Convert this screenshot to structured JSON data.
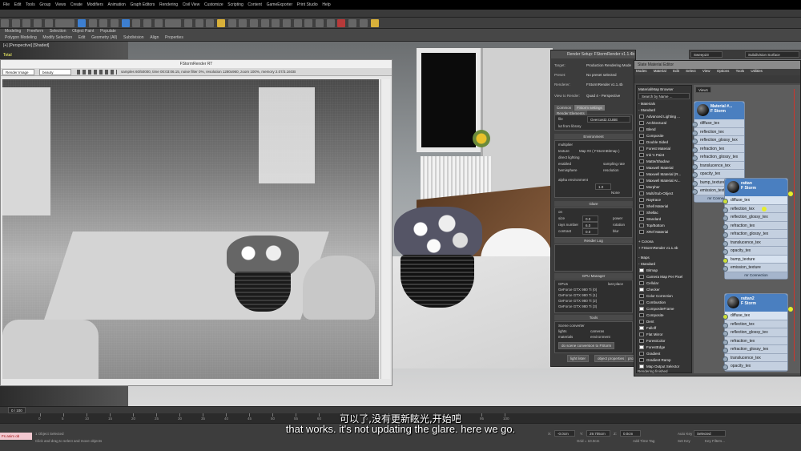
{
  "menubar": {
    "items": [
      "File",
      "Edit",
      "Tools",
      "Group",
      "Views",
      "Create",
      "Modifiers",
      "Animation",
      "Graph Editors",
      "Rendering",
      "Civil View",
      "Customize",
      "Scripting",
      "Content",
      "GameExporter",
      "Print Studio",
      "Help"
    ]
  },
  "ribbon": {
    "tabs": [
      "Modeling",
      "Freeform",
      "Selection",
      "Object Paint",
      "Populate"
    ],
    "subtabs": [
      "Polygon Modeling",
      "Modify Selection",
      "Edit",
      "Geometry (All)",
      "Subdivision",
      "Align",
      "Properties"
    ]
  },
  "viewport": {
    "label": "[+] [Perspective] [Shaded]",
    "total_label": "Total"
  },
  "rt_window": {
    "title": "FStormRender RT",
    "dropdown1": "Render Image",
    "dropdown2": "beauty",
    "stats": "samples 60/50000, time 00:03:06.15, noise filter 0%, resolution 1280x960, zoom 100%, memory 2.07/3.16GB"
  },
  "render_setup": {
    "title": "Render Setup: FStormRender v1.1.4b",
    "target_label": "Target:",
    "target_value": "Production Rendering Mode",
    "preset_label": "Preset:",
    "preset_value": "No preset selected",
    "renderer_label": "Renderer:",
    "renderer_value": "FStormRender v1.1.4b",
    "view_label": "View to Render:",
    "view_value": "Quad 4 - Perspective",
    "tabs": [
      "Common",
      "FStorm settings",
      "Render Elements"
    ],
    "file_label": "file",
    "file_value": "Overcast2.CUBE",
    "library_label": "lut from library",
    "environment_title": "Environment",
    "env_rows": [
      "multiplier",
      "texture",
      "direct lighting",
      "enabled",
      "hemisphere"
    ],
    "env_map": "Map #2 ( FStormBitmap )",
    "sampling_label": "sampling rate",
    "resolution_label": "resolution",
    "alpha_label": "alpha environment",
    "alpha_multiplier": "1.0",
    "texture_none": "None",
    "glare_title": "Glare",
    "glare_rows": [
      "on",
      "size",
      "rays number",
      "contrast"
    ],
    "glare_values": [
      "0.0",
      "6.0",
      "0.0"
    ],
    "glare_right": [
      "power",
      "rotation",
      "blur"
    ],
    "render_log_title": "Render Log",
    "gpu_title": "GPU Manager",
    "gpu_header": [
      "GPUs",
      "last place"
    ],
    "gpus": [
      "GeForce GTX 980 Ti (0)",
      "GeForce GTX 980 Ti (1)",
      "GeForce GTX 980 Ti (2)",
      "GeForce GTX 980 Ti (3)"
    ],
    "tools_title": "Tools",
    "tools_rows": [
      "Scene converter",
      "lights",
      "materials"
    ],
    "tools_right": [
      "cameras",
      "environment"
    ],
    "convert_btn": "do scene conversion to FStorm",
    "light_lister_btn": "light lister",
    "obj_props_btn": "object properties",
    "proxy_btn": "proxy"
  },
  "material_editor": {
    "title": "Slate Material Editor",
    "menu": [
      "Modes",
      "Material",
      "Edit",
      "Select",
      "View",
      "Options",
      "Tools",
      "Utilities"
    ],
    "browser_title": "Material/Map Browser",
    "search_placeholder": "Search by Name ...",
    "cat_materials": "- Materials",
    "cat_standard": "- Standard",
    "materials": [
      "Advanced Lighting ...",
      "Architectural",
      "Blend",
      "Composite",
      "Double Sided",
      "Forest Material",
      "Ink 'n Paint",
      "Matte/Shadow",
      "Maxwell Material",
      "Maxwell Material (R...",
      "Maxwell Material Ar...",
      "Morpher",
      "Multi/Sub-Object",
      "Raytrace",
      "Shell Material",
      "Shellac",
      "Standard",
      "Top/Bottom",
      "XRef Material"
    ],
    "cat_corona": "+ Corona",
    "cat_fstorm": "+ FStormRender v1.1.4b",
    "cat_maps": "- Maps",
    "cat_maps_std": "- Standard",
    "maps": [
      "Bitmap",
      "Camera Map Per Pixel",
      "Cellular",
      "Checker",
      "Color Correction",
      "Combustion",
      "CompositeFrame",
      "Composite",
      "Dent",
      "Falloff",
      "Flat Mirror",
      "ForestColor",
      "ForestEdge",
      "Gradient",
      "Gradient Ramp",
      "Map Output Selector"
    ],
    "status": "Rendering finished",
    "view_tab": "View1",
    "node_top_title": "Material #...",
    "node_top_sub": "F Storm",
    "node_top_slots": [
      "diffuse_tex",
      "reflection_tex",
      "reflection_glossy_tex",
      "refraction_tex",
      "refraction_glossy_tex",
      "translucence_tex",
      "opacity_tex",
      "bump_texture",
      "emission_texture"
    ],
    "node_top_foot": "mr Connection",
    "node1_title": "rattan",
    "node1_sub": "F Storm",
    "node1_slots": [
      "diffuse_tex",
      "reflection_tex",
      "reflection_glossy_tex",
      "refraction_tex",
      "refraction_glossy_tex",
      "translucence_tex",
      "opacity_tex",
      "bump_texture",
      "emission_texture"
    ],
    "node1_foot": "mr Connection",
    "node2_title": "rattan2",
    "node2_sub": "F Storm",
    "node2_slots": [
      "diffuse_tex",
      "reflection_tex",
      "reflection_glossy_tex",
      "refraction_tex",
      "refraction_glossy_tex",
      "translucence_tex",
      "opacity_tex"
    ]
  },
  "right_panel": {
    "field": "Sweep23",
    "subdivision_btn": "Subdivision Surface"
  },
  "timeline": {
    "frame": "0 / 100",
    "ticks": [
      "0",
      "5",
      "10",
      "15",
      "20",
      "25",
      "30",
      "35",
      "40",
      "45",
      "50",
      "55",
      "60",
      "65",
      "70",
      "75",
      "80",
      "85",
      "90",
      "95",
      "100"
    ]
  },
  "status": {
    "script": "Fs anim ob",
    "selected": "1 Object Selected",
    "hint": "Click and drag to select and move objects",
    "x_label": "X:",
    "x_value": "-0.0cm",
    "y_label": "Y:",
    "y_value": "29.705cm",
    "z_label": "Z:",
    "z_value": "0.0cm",
    "grid": "Grid = 10.0cm",
    "add_time_tag": "Add Time Tag",
    "autokey": "Auto Key",
    "autokey_value": "Selected",
    "setkey": "Set Key",
    "key_filters": "Key Filters..."
  },
  "subtitles": {
    "chinese": "可以了,没有更新眩光,开始吧",
    "english": "that works. it's not updating the glare. here we go."
  }
}
